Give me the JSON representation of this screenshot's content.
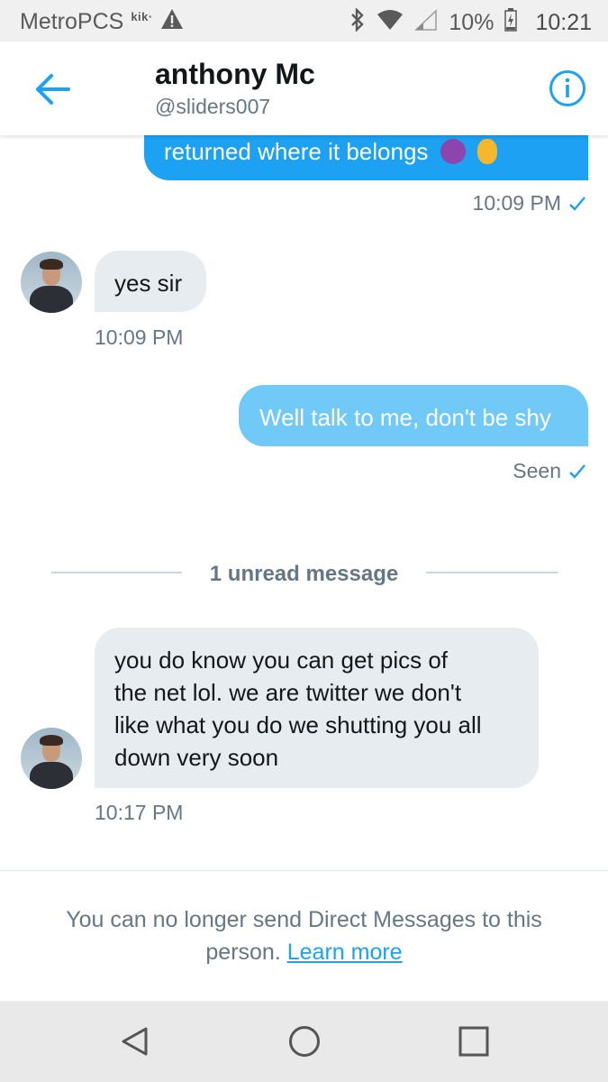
{
  "status_bar": {
    "carrier": "MetroPCS",
    "kik_label": "kik·",
    "battery": "10%",
    "time": "10:21"
  },
  "header": {
    "name": "anthony Mc",
    "handle": "@sliders007"
  },
  "messages": [
    {
      "type": "sent",
      "text": "returned where it belongs",
      "time": "10:09 PM"
    },
    {
      "type": "received",
      "text": "yes sir",
      "time": "10:09 PM"
    },
    {
      "type": "sent",
      "text": "Well talk to me, don't be shy",
      "status": "Seen"
    },
    {
      "type": "received",
      "lines": [
        "you do know you can get pics of",
        "the net lol.  we are twitter we don't",
        "like what you do  we shutting you all",
        "down very soon"
      ],
      "time": "10:17 PM"
    }
  ],
  "unread_divider": "1 unread message",
  "notice": {
    "line1": "You can no longer send Direct Messages to this",
    "line2_prefix": "person. ",
    "link": "Learn more"
  },
  "colors": {
    "accent": "#1da1f2",
    "sent_bubble_light": "#71c9f8",
    "received_bubble": "#e6ecf0",
    "muted_text": "#657786"
  }
}
